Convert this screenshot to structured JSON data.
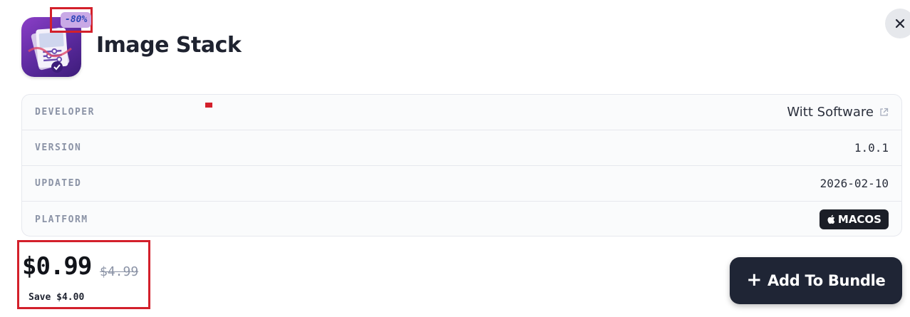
{
  "app": {
    "title": "Image Stack",
    "icon": "image-stack-app-icon",
    "discount_badge": "-80%"
  },
  "close_button": {
    "icon": "close-icon"
  },
  "details": {
    "developer": {
      "label": "DEVELOPER",
      "value": "Witt Software",
      "icon": "external-link-icon"
    },
    "version": {
      "label": "VERSION",
      "value": "1.0.1"
    },
    "updated": {
      "label": "UPDATED",
      "value": "2026-02-10"
    },
    "platform": {
      "label": "PLATFORM",
      "value": "MACOS",
      "icon": "apple-icon"
    }
  },
  "pricing": {
    "current": "$0.99",
    "original": "$4.99",
    "savings": "Save $4.00"
  },
  "actions": {
    "add_to_bundle": "Add To Bundle",
    "add_icon": "plus-icon"
  },
  "colors": {
    "highlight_border": "#d3202b",
    "button_bg": "#1f2535",
    "icon_gradient_start": "#8b3fc7",
    "icon_gradient_end": "#3d1c7a"
  }
}
